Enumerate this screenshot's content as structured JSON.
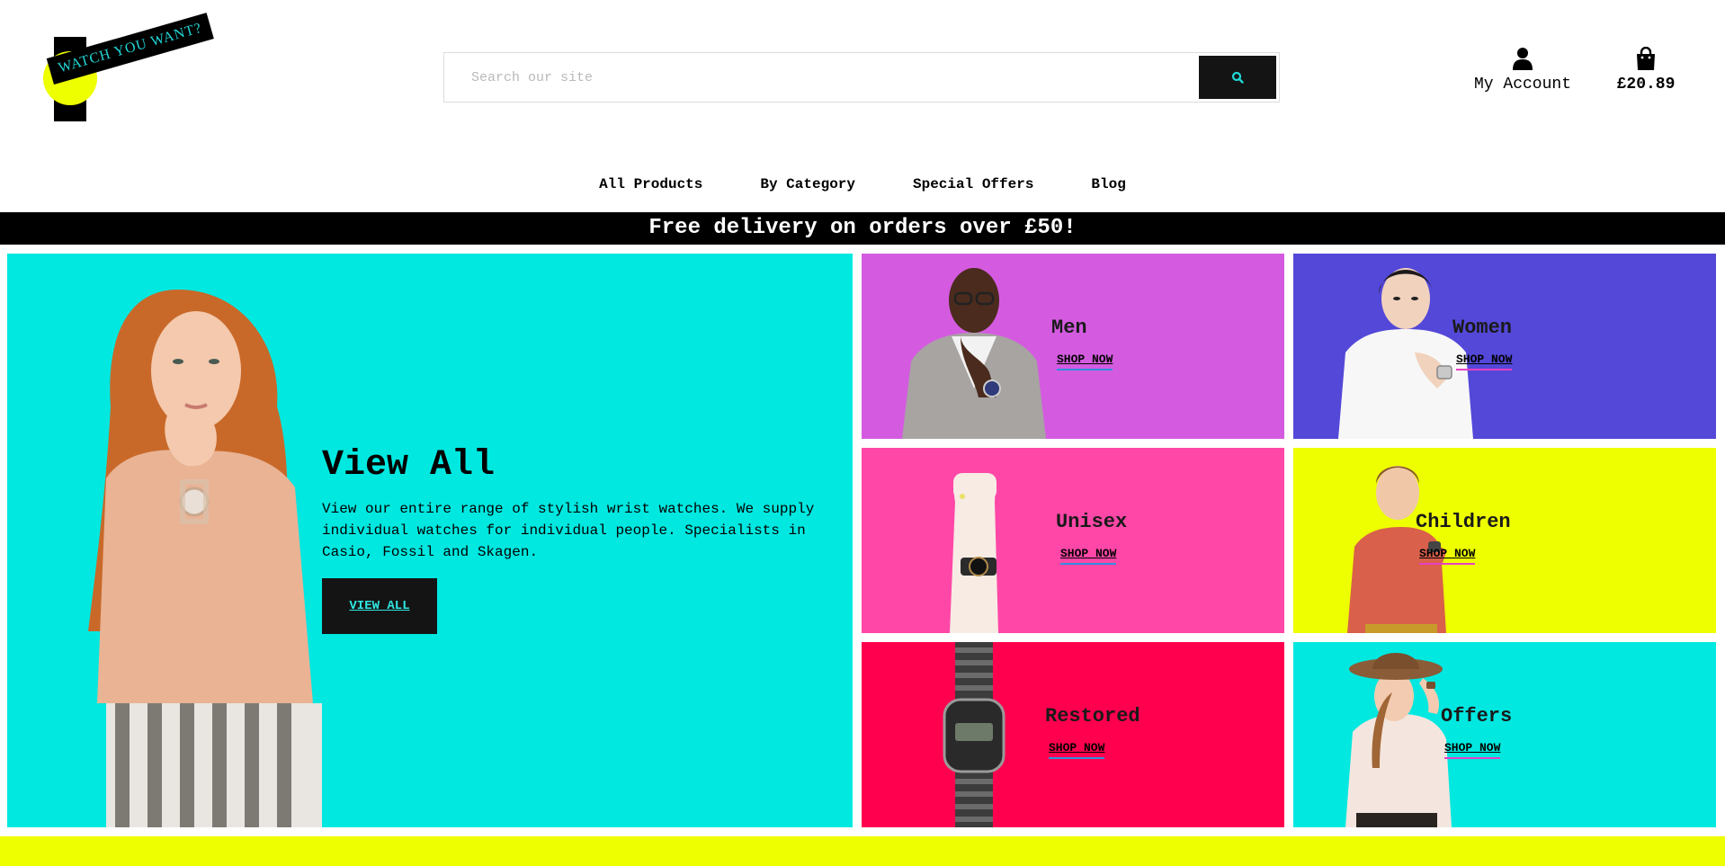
{
  "logo": {
    "text": "WATCH YOU WANT?"
  },
  "search": {
    "placeholder": "Search our site"
  },
  "account": {
    "label": "My Account"
  },
  "cart": {
    "total": "£20.89"
  },
  "nav": {
    "items": [
      "All Products",
      "By Category",
      "Special Offers",
      "Blog"
    ]
  },
  "banner": {
    "text": "Free delivery on orders over £50!"
  },
  "hero": {
    "title": "View All",
    "description": "View our entire range of stylish wrist watches. We supply individual watches for individual people. Specialists in Casio, Fossil and Skagen.",
    "button": "VIEW ALL"
  },
  "tiles": [
    {
      "title": "Men",
      "cta": "SHOP NOW",
      "color": "#d45be0"
    },
    {
      "title": "Women",
      "cta": "SHOP NOW",
      "color": "#5348d8"
    },
    {
      "title": "Unisex",
      "cta": "SHOP NOW",
      "color": "#ff47a8"
    },
    {
      "title": "Children",
      "cta": "SHOP NOW",
      "color": "#eeff00"
    },
    {
      "title": "Restored",
      "cta": "SHOP NOW",
      "color": "#ff004f"
    },
    {
      "title": "Offers",
      "cta": "SHOP NOW",
      "color": "#00e8e0"
    }
  ],
  "colors": {
    "accent_cyan": "#00e8e0",
    "accent_yellow": "#eeff00",
    "dark": "#141414"
  }
}
